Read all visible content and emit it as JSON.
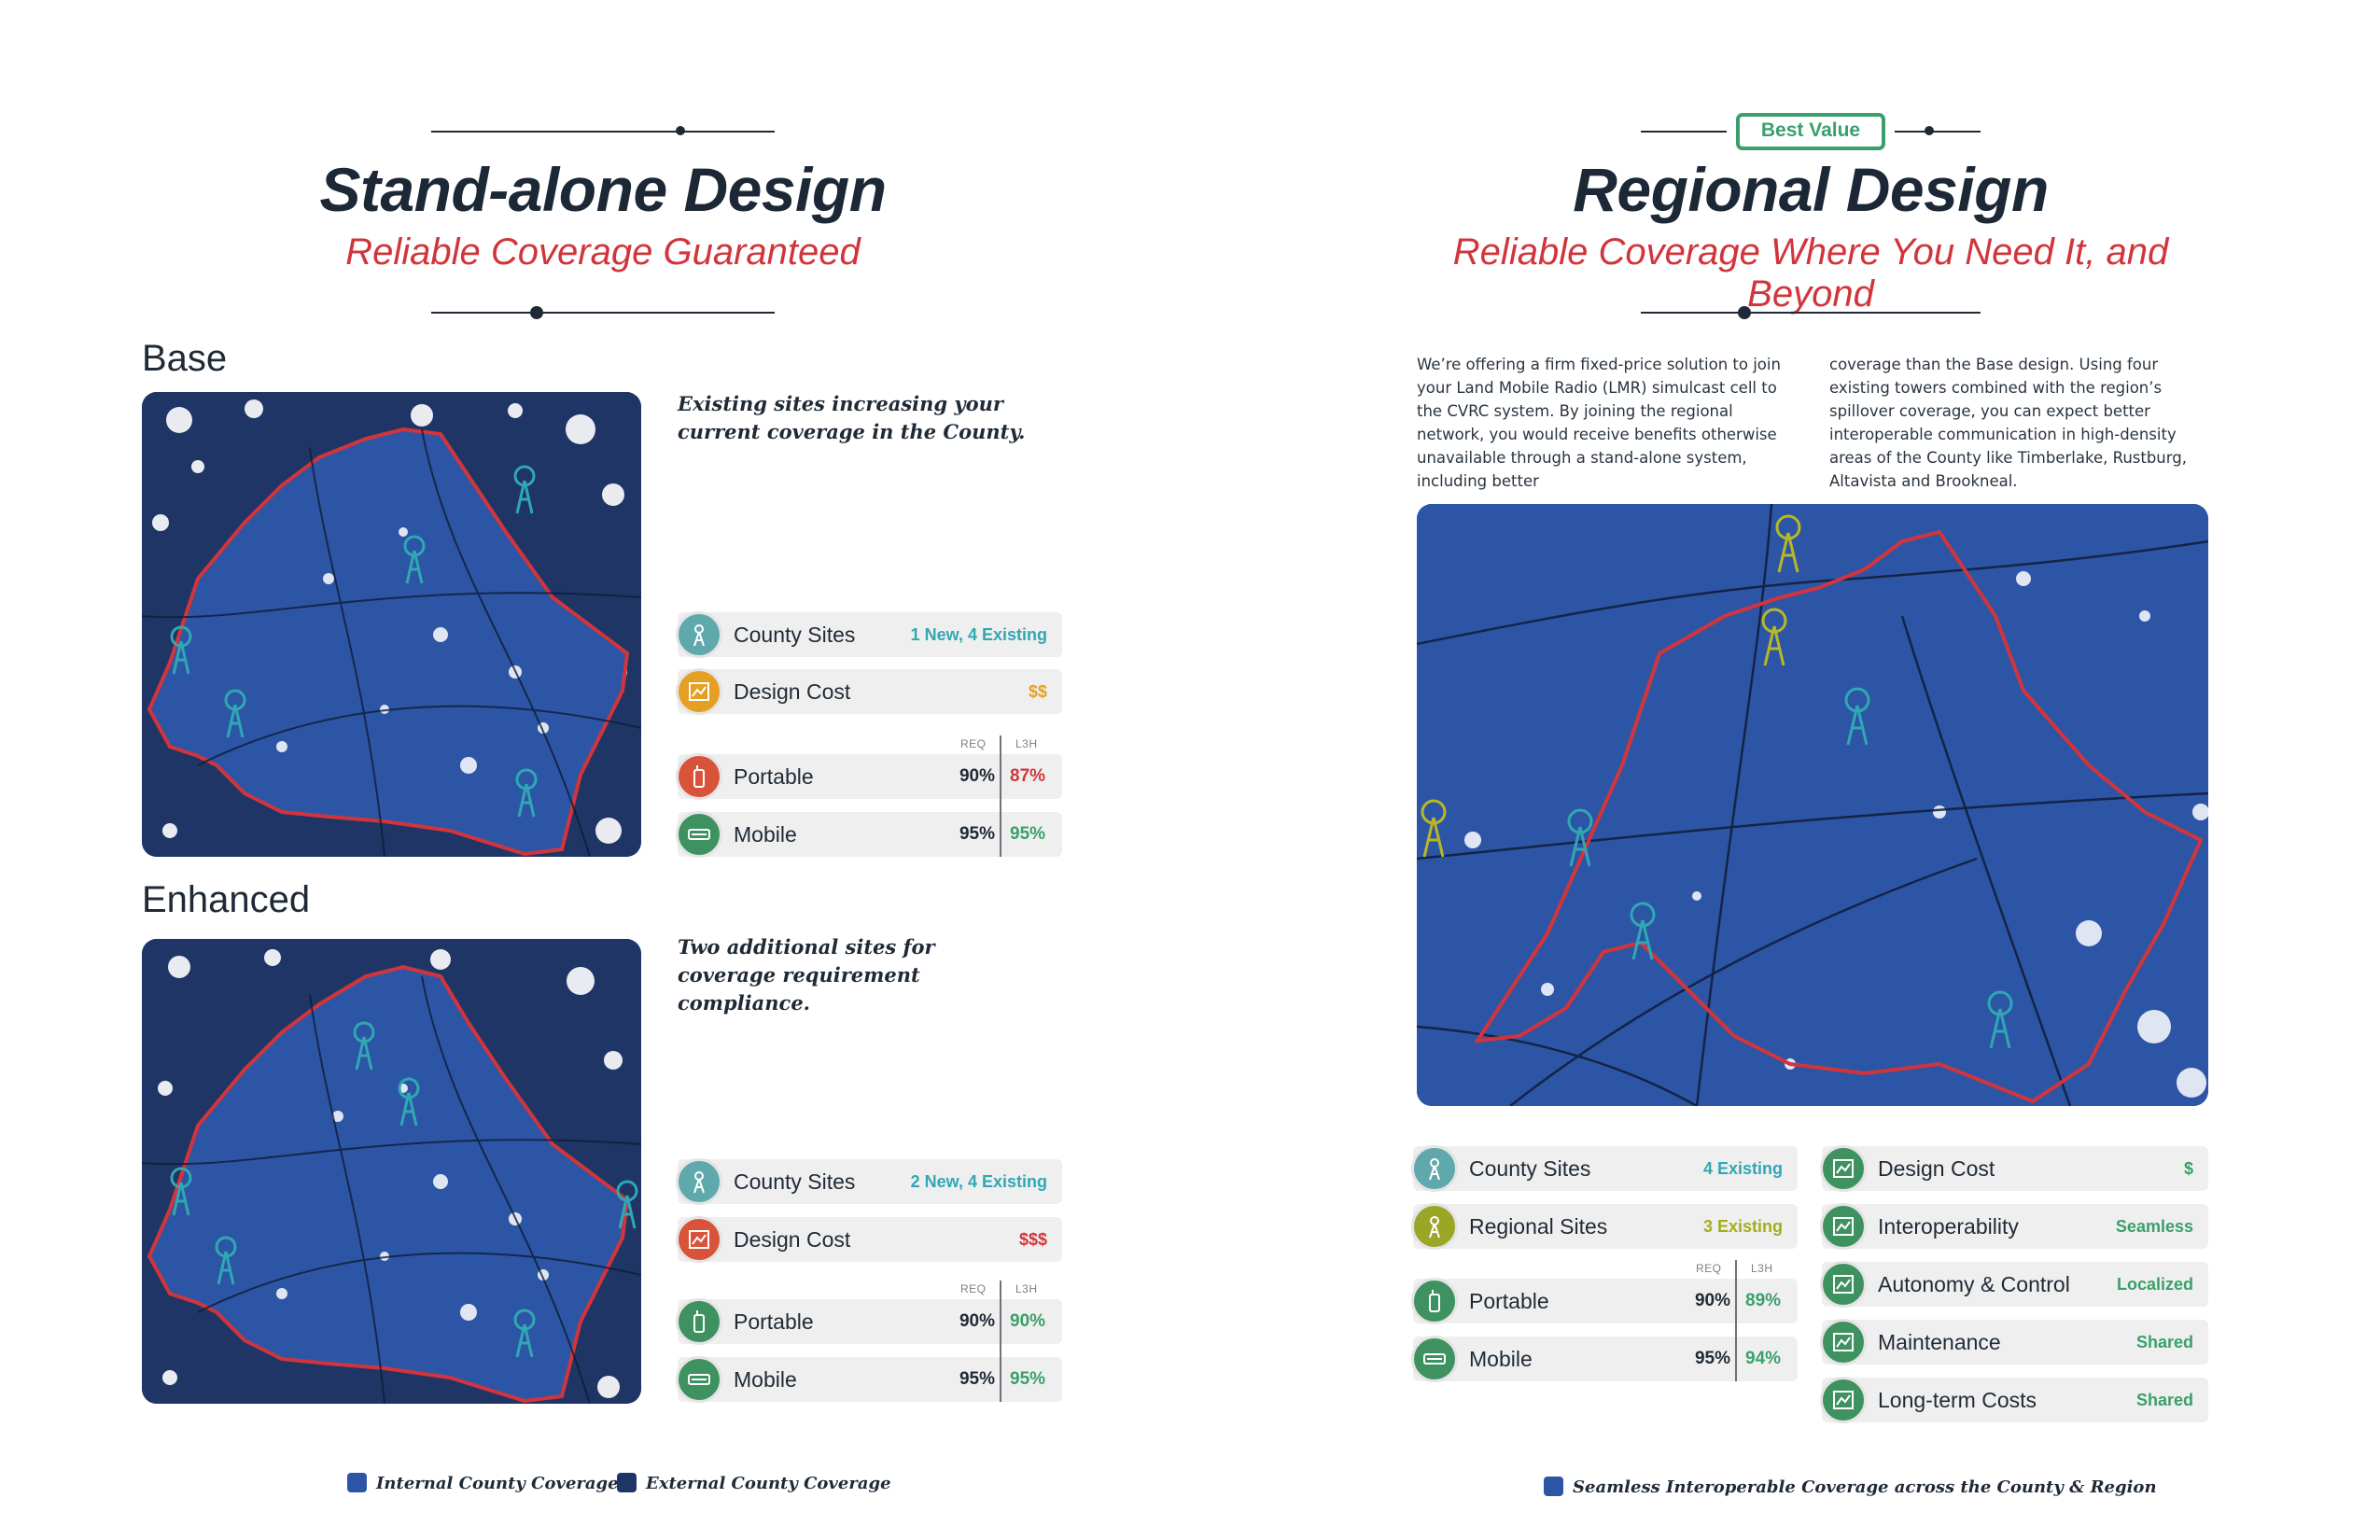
{
  "left": {
    "title": "Stand-alone Design",
    "subtitle": "Reliable Coverage Guaranteed",
    "base": {
      "heading": "Base",
      "caption": "Existing sites increasing your current coverage in the County.",
      "county_sites": {
        "label": "County Sites",
        "value": "1 New, 4 Existing"
      },
      "design_cost": {
        "label": "Design Cost",
        "value": "$$"
      },
      "col_req": "REQ",
      "col_l3h": "L3H",
      "portable": {
        "label": "Portable",
        "req": "90%",
        "l3h": "87%",
        "l3h_color": "#d1353b"
      },
      "mobile": {
        "label": "Mobile",
        "req": "95%",
        "l3h": "95%",
        "l3h_color": "#3aa06b"
      }
    },
    "enhanced": {
      "heading": "Enhanced",
      "caption": "Two additional sites for coverage requirement compliance.",
      "county_sites": {
        "label": "County Sites",
        "value": "2 New, 4 Existing"
      },
      "design_cost": {
        "label": "Design Cost",
        "value": "$$$"
      },
      "col_req": "REQ",
      "col_l3h": "L3H",
      "portable": {
        "label": "Portable",
        "req": "90%",
        "l3h": "90%",
        "l3h_color": "#3aa06b"
      },
      "mobile": {
        "label": "Mobile",
        "req": "95%",
        "l3h": "95%",
        "l3h_color": "#3aa06b"
      }
    },
    "legend": {
      "internal": "Internal County Coverage",
      "external": "External County Coverage"
    }
  },
  "right": {
    "badge": "Best Value",
    "title": "Regional Design",
    "subtitle": "Reliable Coverage Where You Need It, and Beyond",
    "body_col1": "We’re offering a firm fixed-price solution to join your Land Mobile Radio (LMR) simulcast cell to the CVRC system. By joining the regional network, you would receive benefits otherwise unavailable through a stand-alone system, including better",
    "body_col2": "coverage than the Base design. Using four existing towers combined with the region’s spillover coverage, you can expect better interoperable communication in high-density areas of the County like Timberlake, Rustburg, Altavista and Brookneal.",
    "county_sites": {
      "label": "County Sites",
      "value": "4 Existing"
    },
    "regional_sites": {
      "label": "Regional Sites",
      "value": "3 Existing"
    },
    "col_req": "REQ",
    "col_l3h": "L3H",
    "portable": {
      "label": "Portable",
      "req": "90%",
      "l3h": "89%"
    },
    "mobile": {
      "label": "Mobile",
      "req": "95%",
      "l3h": "94%"
    },
    "benefits": [
      {
        "label": "Design Cost",
        "value": "$"
      },
      {
        "label": "Interoperability",
        "value": "Seamless"
      },
      {
        "label": "Autonomy & Control",
        "value": "Localized"
      },
      {
        "label": "Maintenance",
        "value": "Shared"
      },
      {
        "label": "Long-term Costs",
        "value": "Shared"
      }
    ],
    "legend": "Seamless Interoperable Coverage across the County & Region"
  },
  "colors": {
    "navy": "#1c2836",
    "red": "#d1353b",
    "teal": "#2fa8b3",
    "gold": "#e5a023",
    "green": "#3aa06b",
    "olive": "#9aa626",
    "map_internal": "#2d55a5",
    "map_external": "#1e3566"
  },
  "icons": [
    "tower-icon",
    "chart-icon",
    "radio-icon",
    "vehicle-icon"
  ]
}
